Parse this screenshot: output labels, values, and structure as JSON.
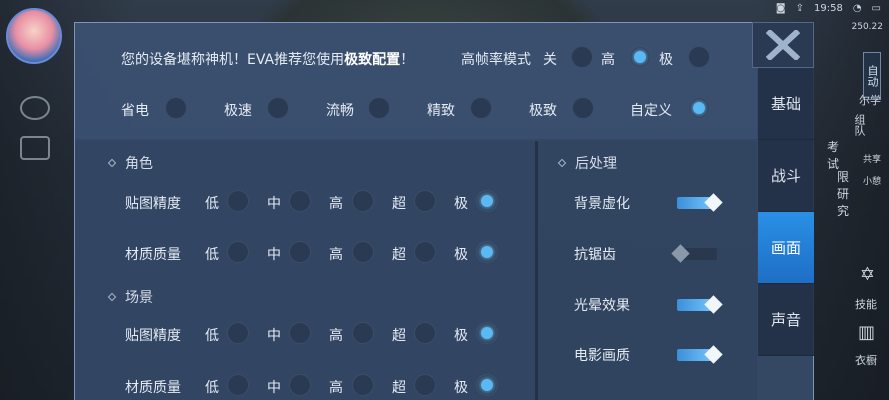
{
  "status_bar": {
    "time": "19:58",
    "signal": "250.22"
  },
  "header": {
    "recommend_text": "您的设备堪称神机！EVA推荐您使用",
    "recommend_highlight": "极致配置",
    "recommend_suffix": "！",
    "hfr_label": "高帧率模式",
    "hfr_options": [
      {
        "label": "关",
        "selected": false
      },
      {
        "label": "高",
        "selected": true
      },
      {
        "label": "极",
        "selected": false
      }
    ]
  },
  "presets": [
    {
      "label": "省电",
      "selected": false
    },
    {
      "label": "极速",
      "selected": false
    },
    {
      "label": "流畅",
      "selected": false
    },
    {
      "label": "精致",
      "selected": false
    },
    {
      "label": "极致",
      "selected": false
    },
    {
      "label": "自定义",
      "selected": true
    }
  ],
  "character_section": {
    "title": "角色",
    "rows": [
      {
        "label": "贴图精度",
        "options": [
          "低",
          "中",
          "高",
          "超",
          "极"
        ],
        "selected_index": 4
      },
      {
        "label": "材质质量",
        "options": [
          "低",
          "中",
          "高",
          "超",
          "极"
        ],
        "selected_index": 4
      }
    ]
  },
  "scene_section": {
    "title": "场景",
    "rows": [
      {
        "label": "贴图精度",
        "options": [
          "低",
          "中",
          "高",
          "超",
          "极"
        ],
        "selected_index": 4
      },
      {
        "label": "材质质量",
        "options": [
          "低",
          "中",
          "高",
          "超",
          "极"
        ],
        "selected_index": 4
      }
    ]
  },
  "post_section": {
    "title": "后处理",
    "toggles": [
      {
        "label": "背景虚化",
        "on": true
      },
      {
        "label": "抗锯齿",
        "on": false
      },
      {
        "label": "光晕效果",
        "on": true
      },
      {
        "label": "电影画质",
        "on": true
      }
    ]
  },
  "tabs": [
    {
      "label": "基础",
      "active": false
    },
    {
      "label": "战斗",
      "active": false
    },
    {
      "label": "画面",
      "active": true
    },
    {
      "label": "声音",
      "active": false
    }
  ],
  "side_hud": {
    "vertical_tag": "自动",
    "texts": [
      "尔学",
      "组队",
      "共享",
      "考试",
      "限研究",
      "小憩",
      "技能",
      "衣橱"
    ]
  },
  "colors": {
    "accent": "#5ab8f2",
    "active_tab": "#2a8fe6",
    "panel": "#364a67"
  }
}
